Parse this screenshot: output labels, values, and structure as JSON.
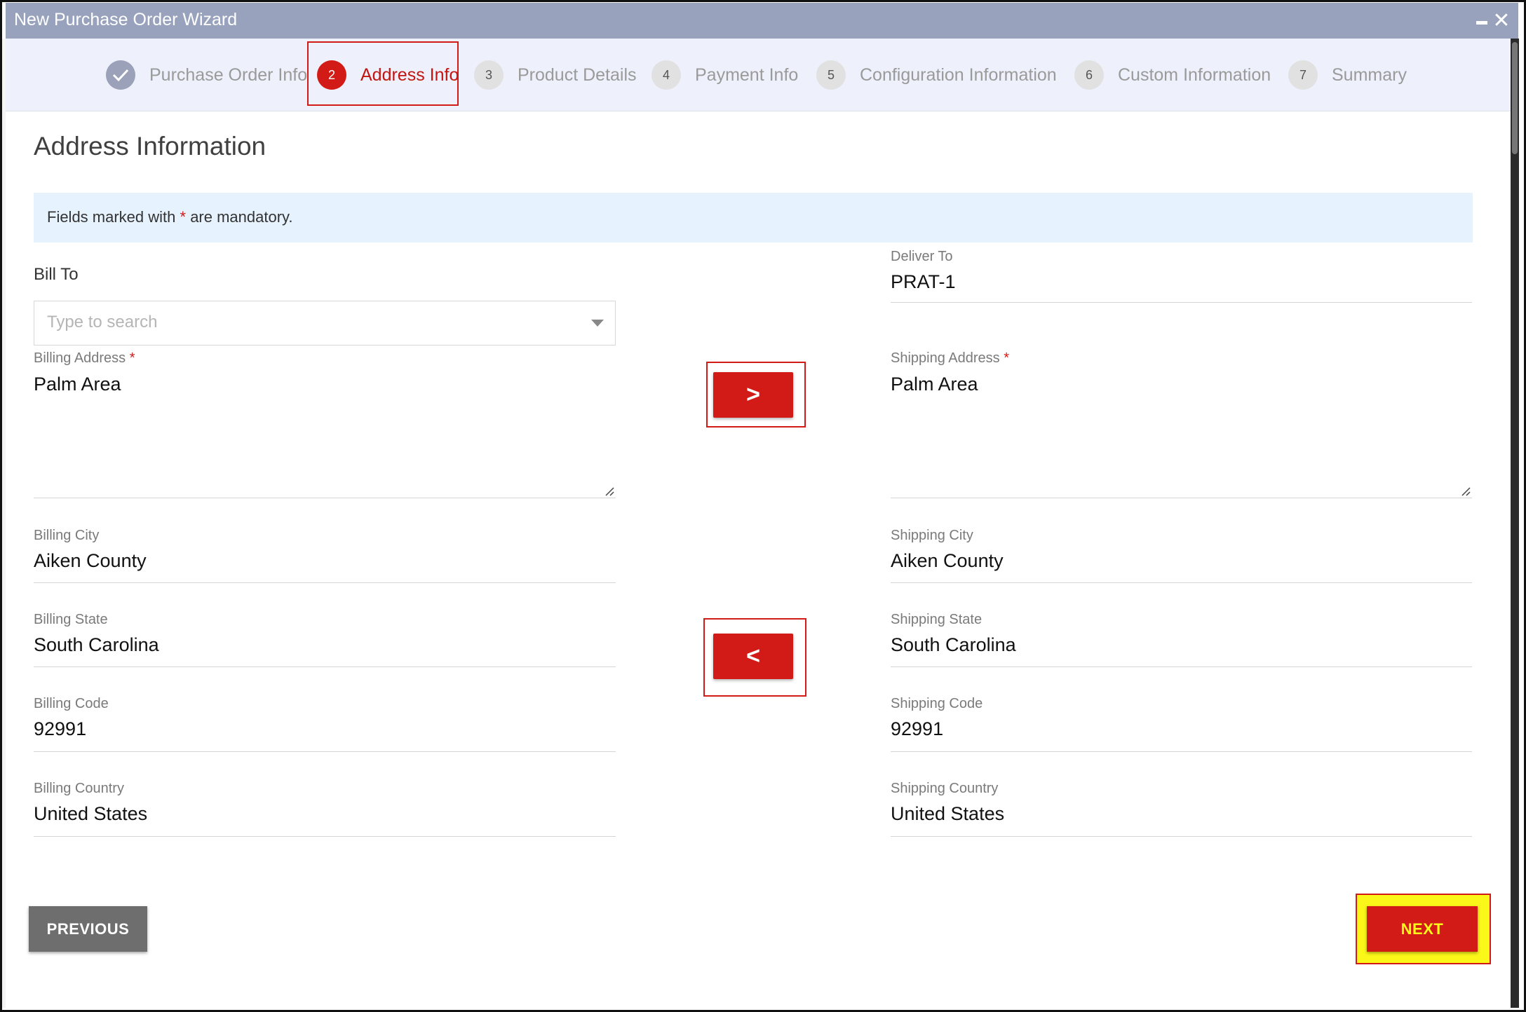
{
  "window": {
    "title": "New Purchase Order Wizard"
  },
  "steps": [
    {
      "number": "",
      "label": "Purchase Order Info",
      "state": "done"
    },
    {
      "number": "2",
      "label": "Address Info",
      "state": "active"
    },
    {
      "number": "3",
      "label": "Product Details",
      "state": "pending"
    },
    {
      "number": "4",
      "label": "Payment Info",
      "state": "pending"
    },
    {
      "number": "5",
      "label": "Configuration Information",
      "state": "pending"
    },
    {
      "number": "6",
      "label": "Custom Information",
      "state": "pending"
    },
    {
      "number": "7",
      "label": "Summary",
      "state": "pending"
    }
  ],
  "section": {
    "heading": "Address Information"
  },
  "notice": {
    "prefix": "Fields marked with ",
    "asterisk": "*",
    "suffix": " are mandatory."
  },
  "billing": {
    "bill_to_label": "Bill To",
    "bill_to_placeholder": "Type to search",
    "address_label": "Billing Address",
    "address_value": "Palm Area",
    "city_label": "Billing City",
    "city_value": "Aiken County",
    "state_label": "Billing State",
    "state_value": "South Carolina",
    "code_label": "Billing Code",
    "code_value": "92991",
    "country_label": "Billing Country",
    "country_value": "United States"
  },
  "shipping": {
    "deliver_to_label": "Deliver To",
    "deliver_to_value": "PRAT-1",
    "address_label": "Shipping Address",
    "address_value": "Palm Area",
    "city_label": "Shipping City",
    "city_value": "Aiken County",
    "state_label": "Shipping State",
    "state_value": "South Carolina",
    "code_label": "Shipping Code",
    "code_value": "92991",
    "country_label": "Shipping Country",
    "country_value": "United States"
  },
  "copy_buttons": {
    "to_shipping": ">",
    "to_billing": "<"
  },
  "footer": {
    "previous_label": "PREVIOUS",
    "next_label": "NEXT"
  },
  "colors": {
    "accent": "#d21b16",
    "titlebar": "#98a2bc",
    "stepbar": "#eef1fb",
    "notice": "#e6f2fd",
    "highlight": "#fbf719"
  }
}
